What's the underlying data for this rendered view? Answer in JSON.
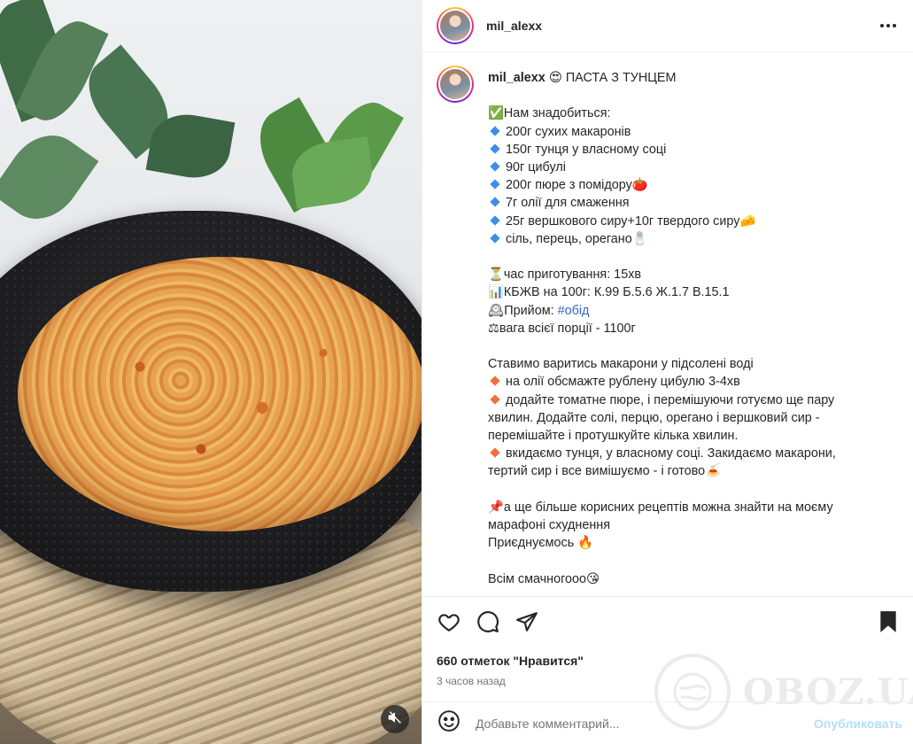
{
  "post": {
    "username": "mil_alexx",
    "caption_title": "😍 ПАСТА З ТУНЦЕМ",
    "caption_lines": [
      "",
      "✅Нам знадобиться:",
      "◆200г сухих макаронів",
      "◆150г тунця у власному соці",
      "◆90г цибулі",
      "◆200г пюре з помідору🍅",
      "◆7г олії для смаження",
      "◆25г вершкового сиру+10г твердого сиру🧀",
      "◆сіль, перець, орегано🧂",
      "",
      "⏳час приготування: 15хв",
      "📊КБЖВ на 100г: К.99 Б.5.6 Ж.1.7 В.15.1",
      "🕰Прийом: #обід",
      "⚖вага всієї порції - 1100г",
      "",
      "Ставимо варитись макарони у підсолені воді",
      "◇на олії обсмажте рублену цибулю 3-4хв",
      "◇додайте томатне пюре, і перемішуючи готуємо ще пару хвилин. Додайте солі, перцю, орегано і вершковий сир - перемішайте і протушкуйте кілька хвилин.",
      "◇вкидаємо тунця, у власному соці. Закидаємо макарони, тертий сир і все вимішуємо - і готово🍝",
      "",
      "📌а ще більше корисних рецептів можна знайти на моєму марафоні схуднення",
      "Приєднуємось 🔥",
      "",
      "Всім смачногооо😘"
    ],
    "likes": "660 отметок \"Нравится\"",
    "time": "3 часов назад"
  },
  "comment": {
    "placeholder": "Добавьте комментарий...",
    "publish_label": "Опубликовать"
  },
  "watermark": {
    "text": "OBOZ.UA"
  },
  "icons": {
    "like": "heart-icon",
    "comment": "comment-icon",
    "share": "paper-plane-icon",
    "save": "bookmark-icon",
    "mute": "volume-muted-icon",
    "emoji": "smiley-icon",
    "more": "more-horizontal-icon"
  },
  "colors": {
    "hashtag": "#3a66c9",
    "publish": "#b2dffc",
    "muted_text": "#737373"
  }
}
